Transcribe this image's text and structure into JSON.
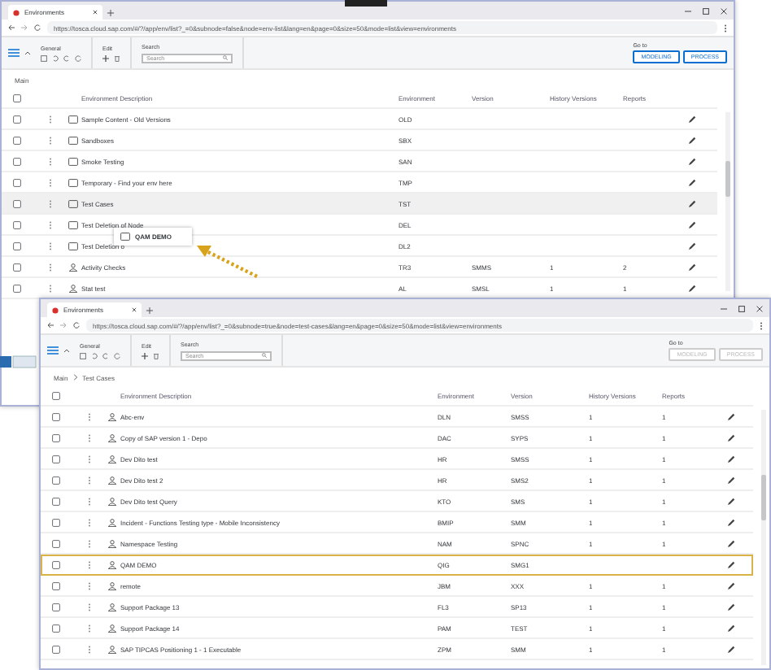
{
  "windows": [
    {
      "tab": {
        "title": "Environments"
      },
      "url": "https://tosca.cloud.sap.com/#/?/app/env/list?_=0&subnode=false&node=env-list&lang=en&page=0&size=50&mode=list&view=environments",
      "toolbar": {
        "general_label": "General",
        "edit_label": "Edit",
        "search_label": "Search",
        "search": {
          "placeholder": "Search"
        },
        "goto_label": "Go to",
        "buttons": [
          {
            "label": "MODELING",
            "disabled": false
          },
          {
            "label": "PROCESS",
            "disabled": false
          }
        ]
      },
      "breadcrumb": [
        "Main"
      ],
      "columns": [
        "Environment Description",
        "Environment",
        "Version",
        "History Versions",
        "Reports"
      ],
      "select_all": {
        "checked": false
      },
      "rows": [
        {
          "kind": "folder",
          "description": "Sample Content - Old Versions",
          "environment": "OLD",
          "checked": false,
          "hovered": false
        },
        {
          "kind": "folder",
          "description": "Sandboxes",
          "environment": "SBX",
          "checked": false,
          "hovered": false
        },
        {
          "kind": "folder",
          "description": "Smoke Testing",
          "environment": "SAN",
          "checked": false,
          "hovered": false
        },
        {
          "kind": "folder",
          "description": "Temporary - Find your env here",
          "environment": "TMP",
          "checked": false,
          "hovered": false
        },
        {
          "kind": "folder",
          "description": "Test Cases",
          "environment": "TST",
          "checked": false,
          "hovered": true
        },
        {
          "kind": "folder",
          "description": "Test Deletion of Node",
          "environment": "DEL",
          "checked": false,
          "hovered": false
        },
        {
          "kind": "folder",
          "description": "Test Deletion o",
          "environment": "DL2",
          "checked": false,
          "hovered": false
        },
        {
          "kind": "user",
          "description": "Activity Checks",
          "environment": "TR3",
          "version": "SMMS",
          "history_versions": "1",
          "reports": "2",
          "checked": false,
          "hovered": false
        },
        {
          "kind": "user",
          "description": "Stat test",
          "environment": "AL",
          "version": "SMSL",
          "history_versions": "1",
          "reports": "1",
          "checked": false,
          "hovered": false
        }
      ]
    },
    {
      "tab": {
        "title": "Environments"
      },
      "url": "https://tosca.cloud.sap.com/#/?/app/env/list?_=0&subnode=true&node=test-cases&lang=en&page=0&size=50&mode=list&view=environments",
      "toolbar": {
        "general_label": "General",
        "edit_label": "Edit",
        "search_label": "Search",
        "search": {
          "placeholder": "Search"
        },
        "goto_label": "Go to",
        "buttons": [
          {
            "label": "MODELING",
            "disabled": true
          },
          {
            "label": "PROCESS",
            "disabled": true
          }
        ]
      },
      "breadcrumb": [
        "Main",
        "Test Cases"
      ],
      "columns": [
        "Environment Description",
        "Environment",
        "Version",
        "History Versions",
        "Reports"
      ],
      "select_all": {
        "checked": false
      },
      "rows": [
        {
          "kind": "user",
          "description": "Abc-env",
          "environment": "DLN",
          "version": "SMSS",
          "history_versions": "1",
          "reports": "1",
          "checked": false,
          "selected": false
        },
        {
          "kind": "user",
          "description": "Copy of SAP version 1 - Depo",
          "environment": "DAC",
          "version": "SYPS",
          "history_versions": "1",
          "reports": "1",
          "checked": false,
          "selected": false
        },
        {
          "kind": "user",
          "description": "Dev Dito test",
          "environment": "HR",
          "version": "SMSS",
          "history_versions": "1",
          "reports": "1",
          "checked": false,
          "selected": false
        },
        {
          "kind": "user",
          "description": "Dev Dito test 2",
          "environment": "HR",
          "version": "SMS2",
          "history_versions": "1",
          "reports": "1",
          "checked": false,
          "selected": false
        },
        {
          "kind": "user",
          "description": "Dev Dito test Query",
          "environment": "KTO",
          "version": "SMS",
          "history_versions": "1",
          "reports": "1",
          "checked": false,
          "selected": false
        },
        {
          "kind": "user",
          "description": "Incident - Functions Testing type - Mobile Inconsistency",
          "environment": "BMIP",
          "version": "SMM",
          "history_versions": "1",
          "reports": "1",
          "checked": false,
          "selected": false
        },
        {
          "kind": "user",
          "description": "Namespace Testing",
          "environment": "NAM",
          "version": "SPNC",
          "history_versions": "1",
          "reports": "1",
          "checked": false,
          "selected": false
        },
        {
          "kind": "user",
          "description": "QAM DEMO",
          "environment": "QIG",
          "version": "SMG1",
          "checked": false,
          "selected": true
        },
        {
          "kind": "user",
          "description": "remote",
          "environment": "JBM",
          "version": "XXX",
          "history_versions": "1",
          "reports": "1",
          "checked": false,
          "selected": false
        },
        {
          "kind": "user",
          "description": "Support Package 13",
          "environment": "FL3",
          "version": "SP13",
          "history_versions": "1",
          "reports": "1",
          "checked": false,
          "selected": false
        },
        {
          "kind": "user",
          "description": "Support Package 14",
          "environment": "PAM",
          "version": "TEST",
          "history_versions": "1",
          "reports": "1",
          "checked": false,
          "selected": false
        },
        {
          "kind": "user",
          "description": "SAP TIPCAS Positioning 1 - 1 Executable",
          "environment": "ZPM",
          "version": "SMM",
          "history_versions": "1",
          "reports": "1",
          "checked": false,
          "selected": false
        }
      ]
    }
  ],
  "drag_ghost": {
    "label": "QAM DEMO"
  }
}
